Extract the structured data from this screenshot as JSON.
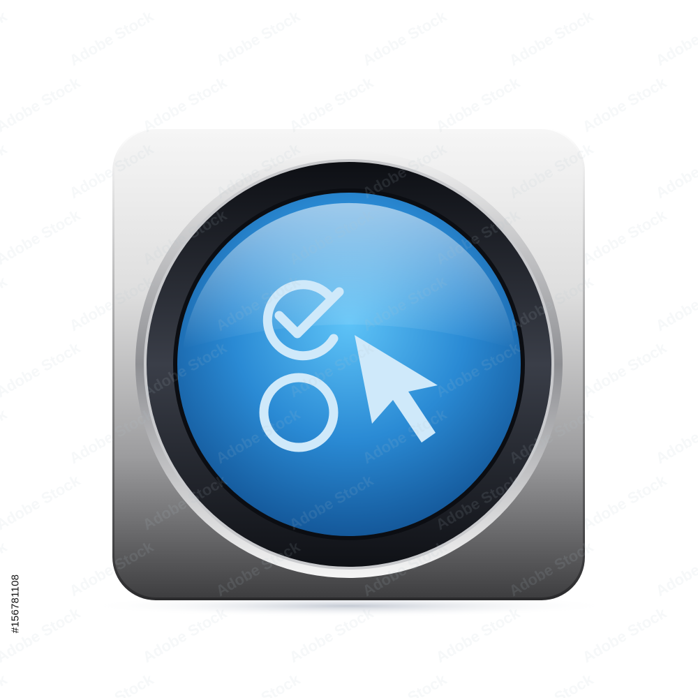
{
  "icon": {
    "name": "radio-option-select-button",
    "symbols": [
      "checked-circle-icon",
      "empty-circle-icon",
      "mouse-pointer-icon"
    ],
    "colors": {
      "background": "#ffffff",
      "frame_light": "#f4f4f4",
      "frame_dark": "#3a3a3c",
      "bezel": "#1c1f26",
      "button_blue": "#2d8fd8",
      "button_blue_light": "#6ccaf8",
      "button_blue_dark": "#13599a",
      "glyph": "#cfe9fa"
    }
  },
  "watermark": {
    "text": "Adobe Stock"
  },
  "stock_id": "#156781108"
}
